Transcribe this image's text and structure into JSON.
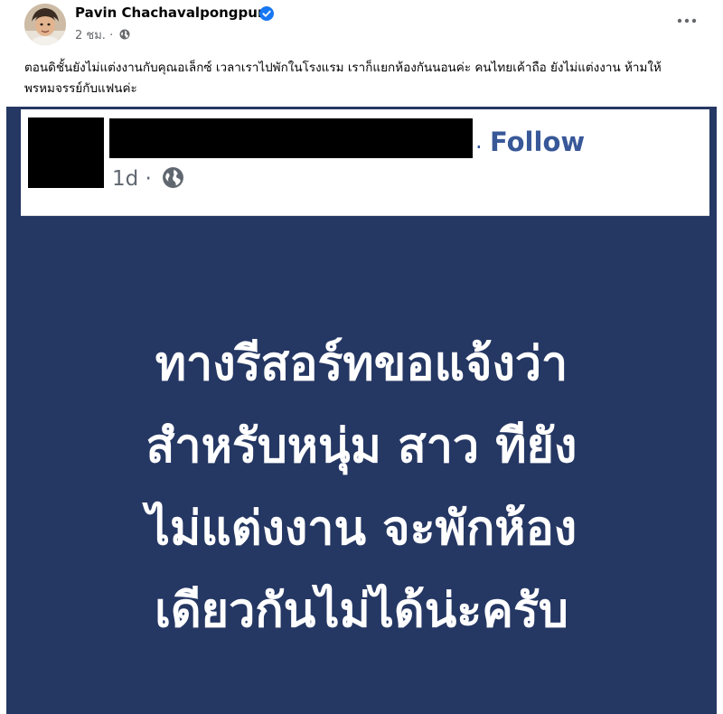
{
  "post": {
    "author_name": "Pavin Chachavalpongpun",
    "timestamp": "2 ชม.",
    "meta_separator": "·",
    "text": "ตอนดิชั้นยังไม่แต่งงานกับคุณอเล็กซ์ เวลาเราไปพักในโรงแรม เราก็แยกห้องกันนอนค่ะ คนไทยเค้าถือ ยังไม่แต่งงาน ห้ามให้พรหมจรรย์กับแฟนค่ะ",
    "more_icon": "more-horizontal-icon",
    "privacy_icon": "globe-icon",
    "verified_color": "#1877f2"
  },
  "embedded": {
    "follow_label": "Follow",
    "time": "1d",
    "meta_separator": "·",
    "background_color": "#253763",
    "announcement_lines": [
      "ทางรีสอร์ทขอแจ้งว่า",
      "สำหรับหนุ่ม  สาว ทียัง",
      "ไม่แต่งงาน จะพักห้อง",
      "เดียวกันไม่ได้น่ะครับ"
    ]
  }
}
